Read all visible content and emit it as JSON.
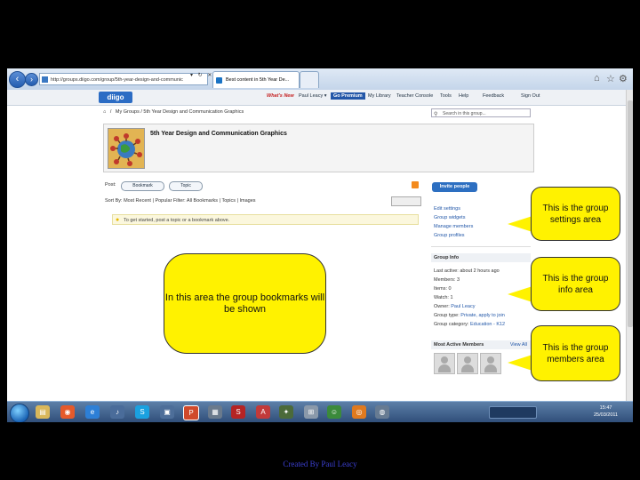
{
  "browser": {
    "address": "http://groups.diigo.com/group/5th-year-design-and-communic",
    "tabs": [
      {
        "label": "Best content in 5th Year De..."
      },
      {
        "label": ""
      }
    ]
  },
  "site": {
    "logo": "diigo",
    "nav": {
      "whats_new": "What's New",
      "user": "Paul Leacy ▾",
      "premium": "Go Premium",
      "library": "My Library",
      "teacher": "Teacher Console",
      "tools": "Tools",
      "help": "Help",
      "feedback": "Feedback",
      "signout": "Sign Out"
    }
  },
  "breadcrumb": "My Groups  /  5th Year Design and Communication Graphics",
  "search_placeholder": "Search in this group...",
  "group": {
    "title": "5th Year Design and Communication Graphics"
  },
  "post": {
    "label": "Post:",
    "bookmark_btn": "Bookmark",
    "topic_btn": "Topic",
    "invite_btn": "Invite people"
  },
  "sortbar": "Sort By:  Most Recent  |  Popular          Filter:  All   Bookmarks  |  Topics  |  Images",
  "hint": "To get started, post a topic or a bookmark above.",
  "side_links": [
    "Edit settings",
    "Group widgets",
    "Manage members",
    "Group profiles"
  ],
  "group_profile": {
    "heading": "Group Info",
    "rows": [
      {
        "label": "Last active:",
        "value": "about 2 hours ago"
      },
      {
        "label": "Members:",
        "value": "3"
      },
      {
        "label": "Items:",
        "value": "0"
      },
      {
        "label": "Watch:",
        "value": "1"
      },
      {
        "label": "Owner:",
        "value": "Paul Leacy"
      },
      {
        "label": "Group type:",
        "value": "Private, apply to join"
      },
      {
        "label": "Group category:",
        "value": "Education - K12"
      }
    ]
  },
  "members": {
    "heading": "Most Active Members",
    "view_all": "View All"
  },
  "callouts": {
    "bookmarks": "In this area the group bookmarks will be shown",
    "settings": "This is the group settings area",
    "info": "This is the group info area",
    "members": "This is the group members area"
  },
  "clock": {
    "time": "15:47",
    "date": "25/03/2011"
  },
  "credit": "Created By Paul Leacy",
  "colors": {
    "callout": "#fff200",
    "accent": "#2d6fc1",
    "background": "#000000"
  }
}
